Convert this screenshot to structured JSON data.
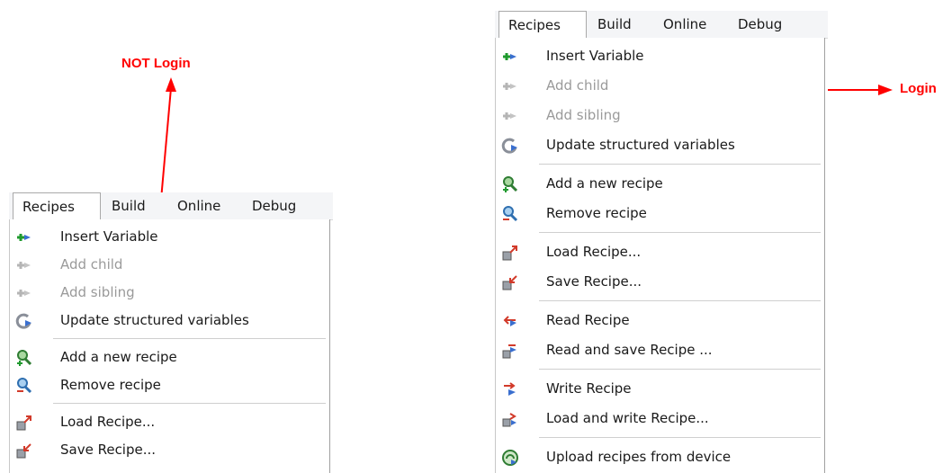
{
  "left_panel": {
    "annotation": "NOT  Login",
    "menubar": [
      "Recipes",
      "Build",
      "Online",
      "Debug"
    ],
    "items": [
      {
        "label": "Insert Variable",
        "icon": "insert-variable-icon",
        "enabled": true
      },
      {
        "label": "Add child",
        "icon": "add-child-icon",
        "enabled": false
      },
      {
        "label": "Add sibling",
        "icon": "add-sibling-icon",
        "enabled": false
      },
      {
        "label": "Update structured variables",
        "icon": "update-variables-icon",
        "enabled": true
      },
      {
        "label": "Add a new recipe",
        "icon": "add-recipe-icon",
        "enabled": true
      },
      {
        "label": "Remove recipe",
        "icon": "remove-recipe-icon",
        "enabled": true
      },
      {
        "label": "Load Recipe...",
        "icon": "load-recipe-icon",
        "enabled": true
      },
      {
        "label": "Save Recipe...",
        "icon": "save-recipe-icon",
        "enabled": true
      }
    ]
  },
  "right_panel": {
    "annotation": "Login",
    "menubar": [
      "Recipes",
      "Build",
      "Online",
      "Debug"
    ],
    "items": [
      {
        "label": "Insert Variable",
        "icon": "insert-variable-icon",
        "enabled": true
      },
      {
        "label": "Add child",
        "icon": "add-child-icon",
        "enabled": false
      },
      {
        "label": "Add sibling",
        "icon": "add-sibling-icon",
        "enabled": false
      },
      {
        "label": "Update structured variables",
        "icon": "update-variables-icon",
        "enabled": true
      },
      {
        "label": "Add a new recipe",
        "icon": "add-recipe-icon",
        "enabled": true
      },
      {
        "label": "Remove recipe",
        "icon": "remove-recipe-icon",
        "enabled": true
      },
      {
        "label": "Load Recipe...",
        "icon": "load-recipe-icon",
        "enabled": true
      },
      {
        "label": "Save Recipe...",
        "icon": "save-recipe-icon",
        "enabled": true
      },
      {
        "label": "Read Recipe",
        "icon": "read-recipe-icon",
        "enabled": true
      },
      {
        "label": "Read and save Recipe ...",
        "icon": "read-save-recipe-icon",
        "enabled": true
      },
      {
        "label": "Write Recipe",
        "icon": "write-recipe-icon",
        "enabled": true
      },
      {
        "label": "Load and write Recipe...",
        "icon": "load-write-recipe-icon",
        "enabled": true
      },
      {
        "label": "Upload recipes from device",
        "icon": "upload-recipes-icon",
        "enabled": true
      }
    ]
  },
  "colors": {
    "annotation": "#ff0000",
    "enabled_text": "#1a1a1a",
    "disabled_text": "#9a9a9a"
  }
}
